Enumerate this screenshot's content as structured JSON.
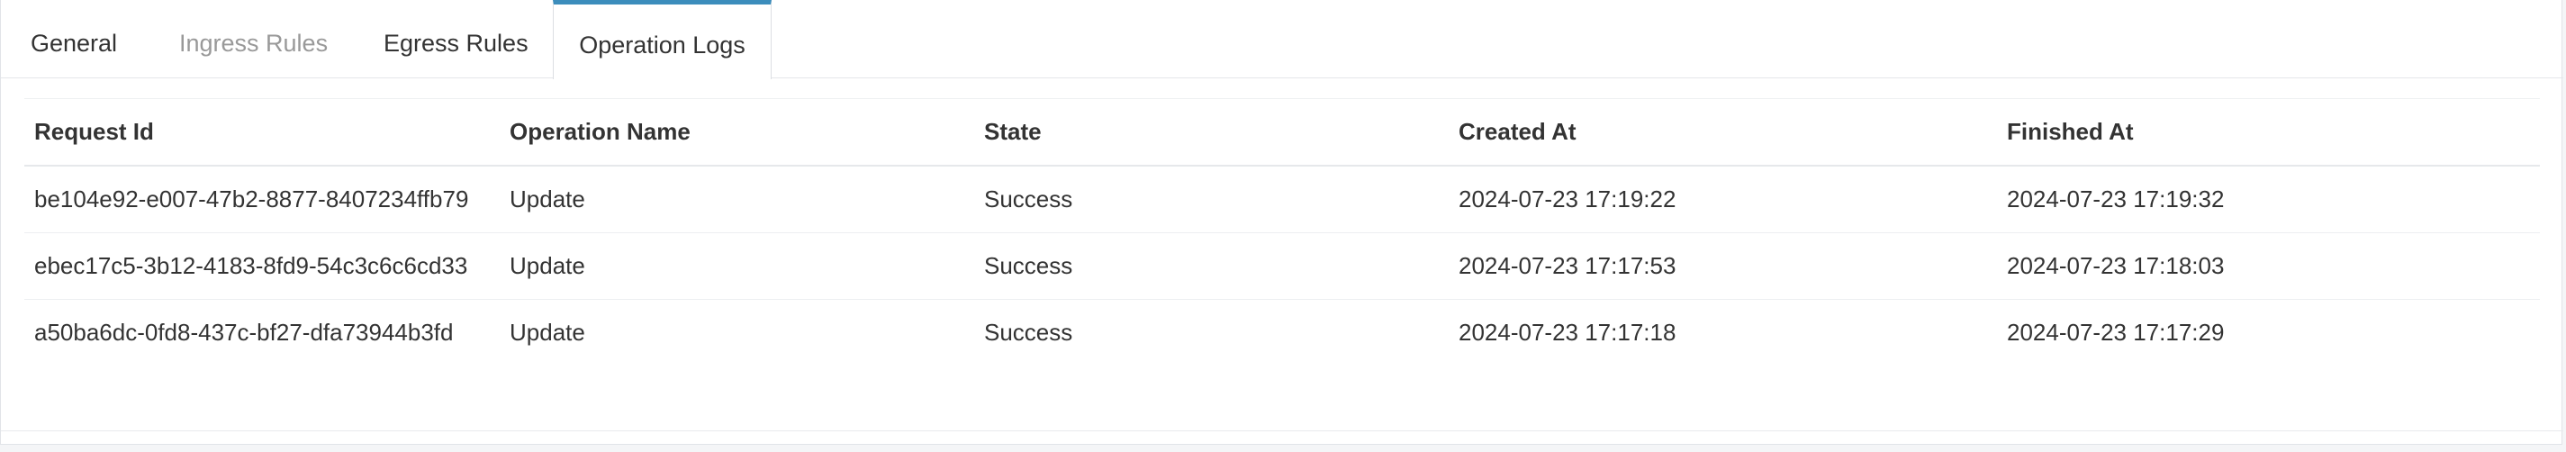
{
  "tabs": [
    {
      "label": "General",
      "state": "normal"
    },
    {
      "label": "Ingress Rules",
      "state": "disabled"
    },
    {
      "label": "Egress Rules",
      "state": "normal"
    },
    {
      "label": "Operation Logs",
      "state": "active"
    }
  ],
  "table": {
    "columns": [
      "Request Id",
      "Operation Name",
      "State",
      "Created At",
      "Finished At"
    ],
    "rows": [
      [
        "be104e92-e007-47b2-8877-8407234ffb79",
        "Update",
        "Success",
        "2024-07-23 17:19:22",
        "2024-07-23 17:19:32"
      ],
      [
        "ebec17c5-3b12-4183-8fd9-54c3c6c6cd33",
        "Update",
        "Success",
        "2024-07-23 17:17:53",
        "2024-07-23 17:18:03"
      ],
      [
        "a50ba6dc-0fd8-437c-bf27-dfa73944b3fd",
        "Update",
        "Success",
        "2024-07-23 17:17:18",
        "2024-07-23 17:17:29"
      ]
    ]
  },
  "colors": {
    "active_tab_accent": "#3c8dbc",
    "disabled_tab_text": "#999999"
  }
}
